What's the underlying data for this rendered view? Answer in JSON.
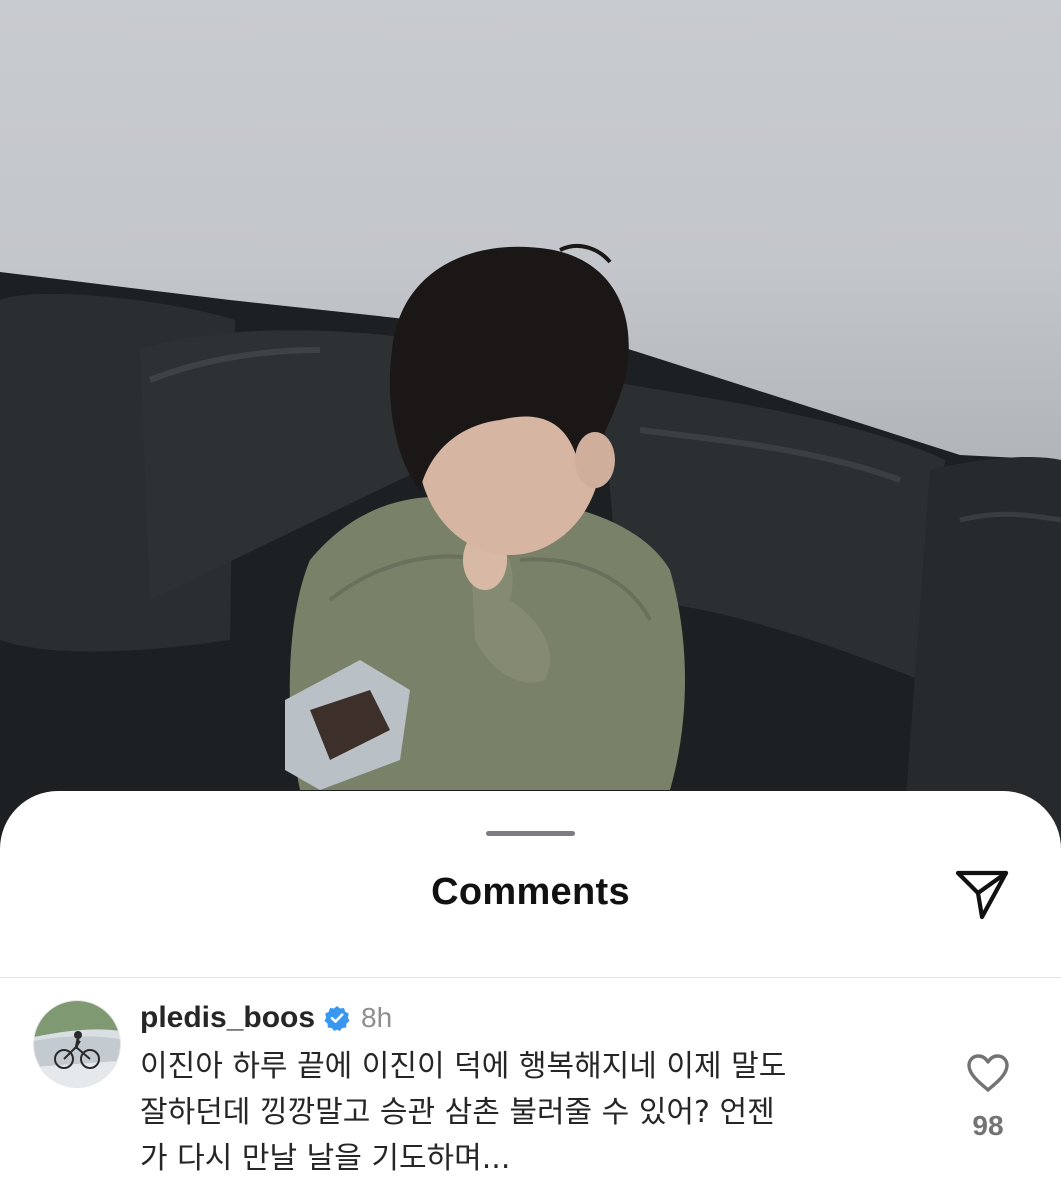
{
  "sheet": {
    "title": "Comments",
    "share_icon": "paper-plane-icon",
    "grabber_icon": "drag-handle"
  },
  "comment": {
    "username": "pledis_boos",
    "verified_icon": "verified-badge-icon",
    "time": "8h",
    "lines": [
      "이진아 하루 끝에 이진이 덕에 행복해지네 이제 말도",
      "잘하던데  낑깡말고 승관 삼촌 불러줄 수 있어?  언젠",
      "가 다시 만날 날을 기도하며..."
    ],
    "like_icon": "heart-outline-icon",
    "like_count": "98"
  },
  "colors": {
    "verified_blue": "#3897f0",
    "text_primary": "#262626",
    "text_secondary": "#8e8e8e",
    "like_count": "#737373"
  }
}
